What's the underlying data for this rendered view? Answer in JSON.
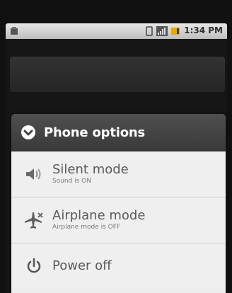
{
  "status_bar": {
    "time": "1:34 PM",
    "icons": [
      "notification-icon",
      "vibrate-icon",
      "signal-icon",
      "battery-icon"
    ]
  },
  "dialog": {
    "title": "Phone options",
    "options": [
      {
        "label": "Silent mode",
        "sublabel": "Sound is ON",
        "icon": "speaker-icon"
      },
      {
        "label": "Airplane mode",
        "sublabel": "Airplane mode is OFF",
        "icon": "airplane-icon"
      },
      {
        "label": "Power off",
        "icon": "power-icon"
      }
    ]
  },
  "colors": {
    "header_bg": "#444444",
    "dialog_bg": "#ededed",
    "label_text": "#5a5a5a"
  }
}
